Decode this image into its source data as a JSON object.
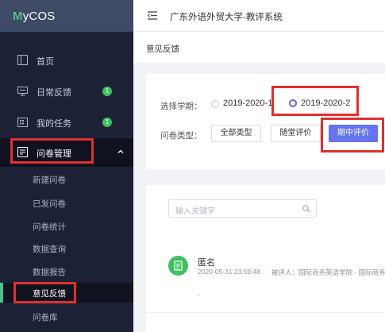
{
  "app": {
    "logo": "MyCOS",
    "logo_first": "M",
    "logo_rest": "yCOS",
    "title": "广东外语外贸大学-教评系统"
  },
  "sidebar": {
    "items": [
      {
        "label": "首页",
        "icon": "layout-icon"
      },
      {
        "label": "日常反馈",
        "icon": "monitor-icon",
        "badge": "1"
      },
      {
        "label": "我的任务",
        "icon": "calendar-icon",
        "badge": "1"
      },
      {
        "label": "问卷管理",
        "icon": "survey-icon",
        "expanded": true
      }
    ],
    "sub_items": [
      {
        "label": "新建问卷"
      },
      {
        "label": "已发问卷"
      },
      {
        "label": "问卷统计"
      },
      {
        "label": "数据查询"
      },
      {
        "label": "数据报告"
      },
      {
        "label": "意见反馈",
        "active": true
      },
      {
        "label": "问卷库"
      }
    ]
  },
  "breadcrumb": "意见反馈",
  "filters": {
    "term_label": "选择学期：",
    "terms": [
      {
        "label": "2019-2020-1",
        "checked": false
      },
      {
        "label": "2019-2020-2",
        "checked": true
      }
    ],
    "type_label": "问卷类型：",
    "types": [
      {
        "label": "全部类型",
        "selected": false
      },
      {
        "label": "随堂评价",
        "selected": false
      },
      {
        "label": "期中评价",
        "selected": true
      }
    ]
  },
  "search": {
    "placeholder": "输入关键字"
  },
  "feedback": [
    {
      "name": "匿名",
      "timestamp": "2020-05-31 23:59:48",
      "evaluator": "被评人：国际商务英语学院 - 国际商务英",
      "content": "."
    }
  ],
  "colors": {
    "sidebar_bg": "#1c2136",
    "accent_green": "#4fc08d",
    "primary": "#6674f0",
    "annotation_red": "#e0302f"
  }
}
